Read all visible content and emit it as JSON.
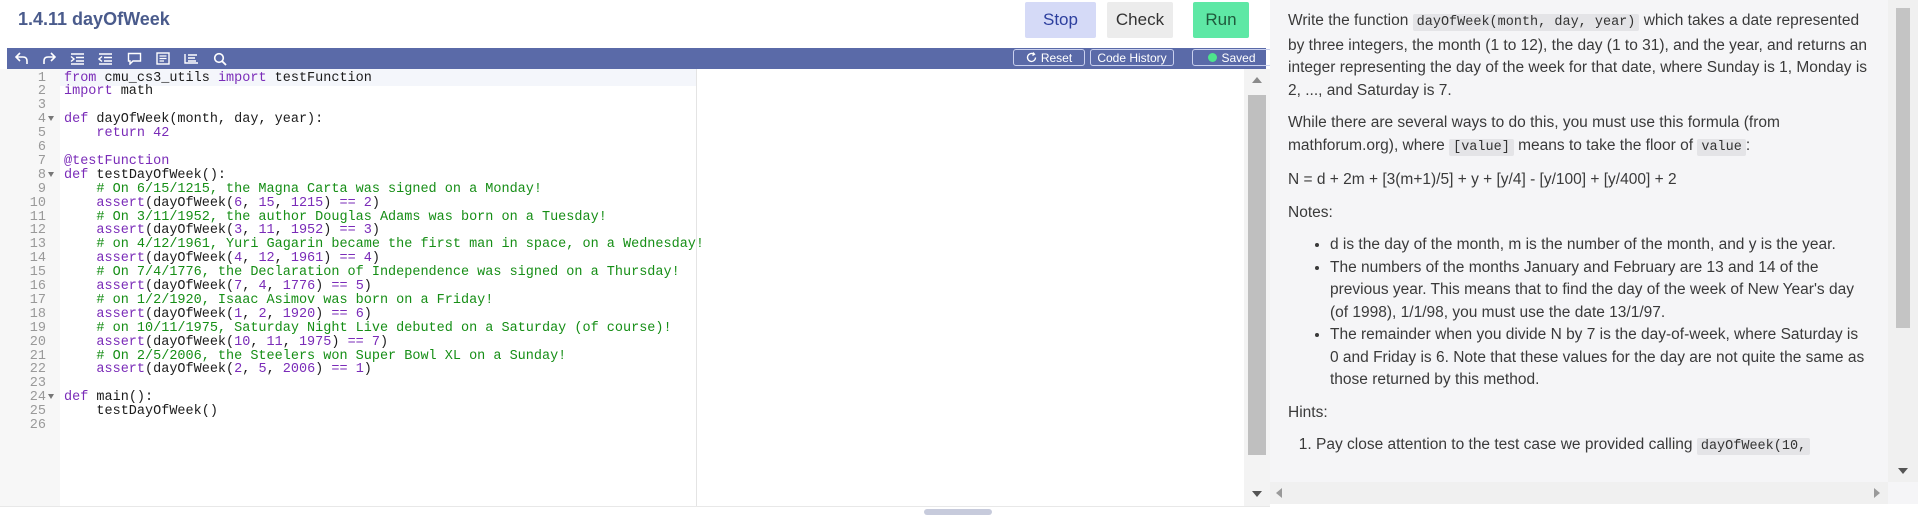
{
  "header": {
    "title": "1.4.11 dayOfWeek",
    "stop_label": "Stop",
    "check_label": "Check",
    "run_label": "Run"
  },
  "toolbar": {
    "icons": [
      "undo-icon",
      "redo-icon",
      "indent-icon",
      "outdent-icon",
      "comment-icon",
      "format-icon",
      "wrap-icon",
      "search-icon"
    ],
    "reset_label": "Reset",
    "history_label": "Code History",
    "saved_label": "Saved"
  },
  "editor": {
    "lines": [
      {
        "n": "1",
        "fold": false,
        "tokens": [
          [
            "kw",
            "from"
          ],
          [
            "fn",
            " cmu_cs3_utils "
          ],
          [
            "kw",
            "import"
          ],
          [
            "fn",
            " testFunction"
          ]
        ]
      },
      {
        "n": "2",
        "fold": false,
        "tokens": [
          [
            "kw",
            "import"
          ],
          [
            "fn",
            " math"
          ]
        ]
      },
      {
        "n": "3",
        "fold": false,
        "tokens": []
      },
      {
        "n": "4",
        "fold": true,
        "tokens": [
          [
            "kw",
            "def"
          ],
          [
            "fn",
            " dayOfWeek(month, day, year):"
          ]
        ]
      },
      {
        "n": "5",
        "fold": false,
        "tokens": [
          [
            "fn",
            "    "
          ],
          [
            "kw",
            "return"
          ],
          [
            "fn",
            " "
          ],
          [
            "num",
            "42"
          ]
        ]
      },
      {
        "n": "6",
        "fold": false,
        "tokens": []
      },
      {
        "n": "7",
        "fold": false,
        "tokens": [
          [
            "kw",
            "@testFunction"
          ]
        ]
      },
      {
        "n": "8",
        "fold": true,
        "tokens": [
          [
            "kw",
            "def"
          ],
          [
            "fn",
            " testDayOfWeek():"
          ]
        ]
      },
      {
        "n": "9",
        "fold": false,
        "tokens": [
          [
            "fn",
            "    "
          ],
          [
            "cm",
            "# On 6/15/1215, the Magna Carta was signed on a Monday!"
          ]
        ]
      },
      {
        "n": "10",
        "fold": false,
        "tokens": [
          [
            "fn",
            "    "
          ],
          [
            "kw",
            "assert"
          ],
          [
            "fn",
            "(dayOfWeek("
          ],
          [
            "num",
            "6"
          ],
          [
            "fn",
            ", "
          ],
          [
            "num",
            "15"
          ],
          [
            "fn",
            ", "
          ],
          [
            "num",
            "1215"
          ],
          [
            "fn",
            ") "
          ],
          [
            "kw",
            "=="
          ],
          [
            "fn",
            " "
          ],
          [
            "num",
            "2"
          ],
          [
            "fn",
            ")"
          ]
        ]
      },
      {
        "n": "11",
        "fold": false,
        "tokens": [
          [
            "fn",
            "    "
          ],
          [
            "cm",
            "# On 3/11/1952, the author Douglas Adams was born on a Tuesday!"
          ]
        ]
      },
      {
        "n": "12",
        "fold": false,
        "tokens": [
          [
            "fn",
            "    "
          ],
          [
            "kw",
            "assert"
          ],
          [
            "fn",
            "(dayOfWeek("
          ],
          [
            "num",
            "3"
          ],
          [
            "fn",
            ", "
          ],
          [
            "num",
            "11"
          ],
          [
            "fn",
            ", "
          ],
          [
            "num",
            "1952"
          ],
          [
            "fn",
            ") "
          ],
          [
            "kw",
            "=="
          ],
          [
            "fn",
            " "
          ],
          [
            "num",
            "3"
          ],
          [
            "fn",
            ")"
          ]
        ]
      },
      {
        "n": "13",
        "fold": false,
        "tokens": [
          [
            "fn",
            "    "
          ],
          [
            "cm",
            "# on 4/12/1961, Yuri Gagarin became the first man in space, on a Wednesday!"
          ]
        ]
      },
      {
        "n": "14",
        "fold": false,
        "tokens": [
          [
            "fn",
            "    "
          ],
          [
            "kw",
            "assert"
          ],
          [
            "fn",
            "(dayOfWeek("
          ],
          [
            "num",
            "4"
          ],
          [
            "fn",
            ", "
          ],
          [
            "num",
            "12"
          ],
          [
            "fn",
            ", "
          ],
          [
            "num",
            "1961"
          ],
          [
            "fn",
            ") "
          ],
          [
            "kw",
            "=="
          ],
          [
            "fn",
            " "
          ],
          [
            "num",
            "4"
          ],
          [
            "fn",
            ")"
          ]
        ]
      },
      {
        "n": "15",
        "fold": false,
        "tokens": [
          [
            "fn",
            "    "
          ],
          [
            "cm",
            "# On 7/4/1776, the Declaration of Independence was signed on a Thursday!"
          ]
        ]
      },
      {
        "n": "16",
        "fold": false,
        "tokens": [
          [
            "fn",
            "    "
          ],
          [
            "kw",
            "assert"
          ],
          [
            "fn",
            "(dayOfWeek("
          ],
          [
            "num",
            "7"
          ],
          [
            "fn",
            ", "
          ],
          [
            "num",
            "4"
          ],
          [
            "fn",
            ", "
          ],
          [
            "num",
            "1776"
          ],
          [
            "fn",
            ") "
          ],
          [
            "kw",
            "=="
          ],
          [
            "fn",
            " "
          ],
          [
            "num",
            "5"
          ],
          [
            "fn",
            ")"
          ]
        ]
      },
      {
        "n": "17",
        "fold": false,
        "tokens": [
          [
            "fn",
            "    "
          ],
          [
            "cm",
            "# on 1/2/1920, Isaac Asimov was born on a Friday!"
          ]
        ]
      },
      {
        "n": "18",
        "fold": false,
        "tokens": [
          [
            "fn",
            "    "
          ],
          [
            "kw",
            "assert"
          ],
          [
            "fn",
            "(dayOfWeek("
          ],
          [
            "num",
            "1"
          ],
          [
            "fn",
            ", "
          ],
          [
            "num",
            "2"
          ],
          [
            "fn",
            ", "
          ],
          [
            "num",
            "1920"
          ],
          [
            "fn",
            ") "
          ],
          [
            "kw",
            "=="
          ],
          [
            "fn",
            " "
          ],
          [
            "num",
            "6"
          ],
          [
            "fn",
            ")"
          ]
        ]
      },
      {
        "n": "19",
        "fold": false,
        "tokens": [
          [
            "fn",
            "    "
          ],
          [
            "cm",
            "# on 10/11/1975, Saturday Night Live debuted on a Saturday (of course)!"
          ]
        ]
      },
      {
        "n": "20",
        "fold": false,
        "tokens": [
          [
            "fn",
            "    "
          ],
          [
            "kw",
            "assert"
          ],
          [
            "fn",
            "(dayOfWeek("
          ],
          [
            "num",
            "10"
          ],
          [
            "fn",
            ", "
          ],
          [
            "num",
            "11"
          ],
          [
            "fn",
            ", "
          ],
          [
            "num",
            "1975"
          ],
          [
            "fn",
            ") "
          ],
          [
            "kw",
            "=="
          ],
          [
            "fn",
            " "
          ],
          [
            "num",
            "7"
          ],
          [
            "fn",
            ")"
          ]
        ]
      },
      {
        "n": "21",
        "fold": false,
        "tokens": [
          [
            "fn",
            "    "
          ],
          [
            "cm",
            "# On 2/5/2006, the Steelers won Super Bowl XL on a Sunday!"
          ]
        ]
      },
      {
        "n": "22",
        "fold": false,
        "tokens": [
          [
            "fn",
            "    "
          ],
          [
            "kw",
            "assert"
          ],
          [
            "fn",
            "(dayOfWeek("
          ],
          [
            "num",
            "2"
          ],
          [
            "fn",
            ", "
          ],
          [
            "num",
            "5"
          ],
          [
            "fn",
            ", "
          ],
          [
            "num",
            "2006"
          ],
          [
            "fn",
            ") "
          ],
          [
            "kw",
            "=="
          ],
          [
            "fn",
            " "
          ],
          [
            "num",
            "1"
          ],
          [
            "fn",
            ")"
          ]
        ]
      },
      {
        "n": "23",
        "fold": false,
        "tokens": []
      },
      {
        "n": "24",
        "fold": true,
        "tokens": [
          [
            "kw",
            "def"
          ],
          [
            "fn",
            " main():"
          ]
        ]
      },
      {
        "n": "25",
        "fold": false,
        "tokens": [
          [
            "fn",
            "    testDayOfWeek()"
          ]
        ]
      },
      {
        "n": "26",
        "fold": false,
        "tokens": []
      }
    ]
  },
  "description": {
    "p1": [
      {
        "t": "text",
        "v": "Write the function "
      },
      {
        "t": "code",
        "v": "dayOfWeek(month, day, year)"
      },
      {
        "t": "text",
        "v": " which takes a date represented by three integers, the month (1 to 12), the day (1 to 31), and the year, and returns an integer representing the day of the week for that date, where Sunday is 1, Monday is 2, ..., and Saturday is 7."
      }
    ],
    "p2": [
      {
        "t": "text",
        "v": "While there are several ways to do this, you must use this formula (from mathforum.org), where "
      },
      {
        "t": "code",
        "v": "[value]"
      },
      {
        "t": "text",
        "v": " means to take the floor of "
      },
      {
        "t": "code",
        "v": "value"
      },
      {
        "t": "text",
        "v": ":"
      }
    ],
    "formula": "N = d + 2m + [3(m+1)/5] + y + [y/4] - [y/100] + [y/400] + 2",
    "notes_label": "Notes:",
    "notes": [
      "d is the day of the month, m is the number of the month, and y is the year.",
      "The numbers of the months January and February are 13 and 14 of the previous year. This means that to find the day of the week of New Year's day (of 1998), 1/1/98, you must use the date 13/1/97.",
      "The remainder when you divide N by 7 is the day-of-week, where Saturday is 0 and Friday is 6. Note that these values for the day are not quite the same as those returned by this method."
    ],
    "hints_label": "Hints:",
    "hint1": [
      {
        "t": "text",
        "v": "Pay close attention to the test case we provided calling "
      },
      {
        "t": "code",
        "v": "dayOfWeek(10,"
      }
    ]
  },
  "colors": {
    "accent": "#5a6aa8",
    "run": "#5ee8a5",
    "stop": "#d5daf7",
    "saved_dot": "#4ee58c"
  }
}
